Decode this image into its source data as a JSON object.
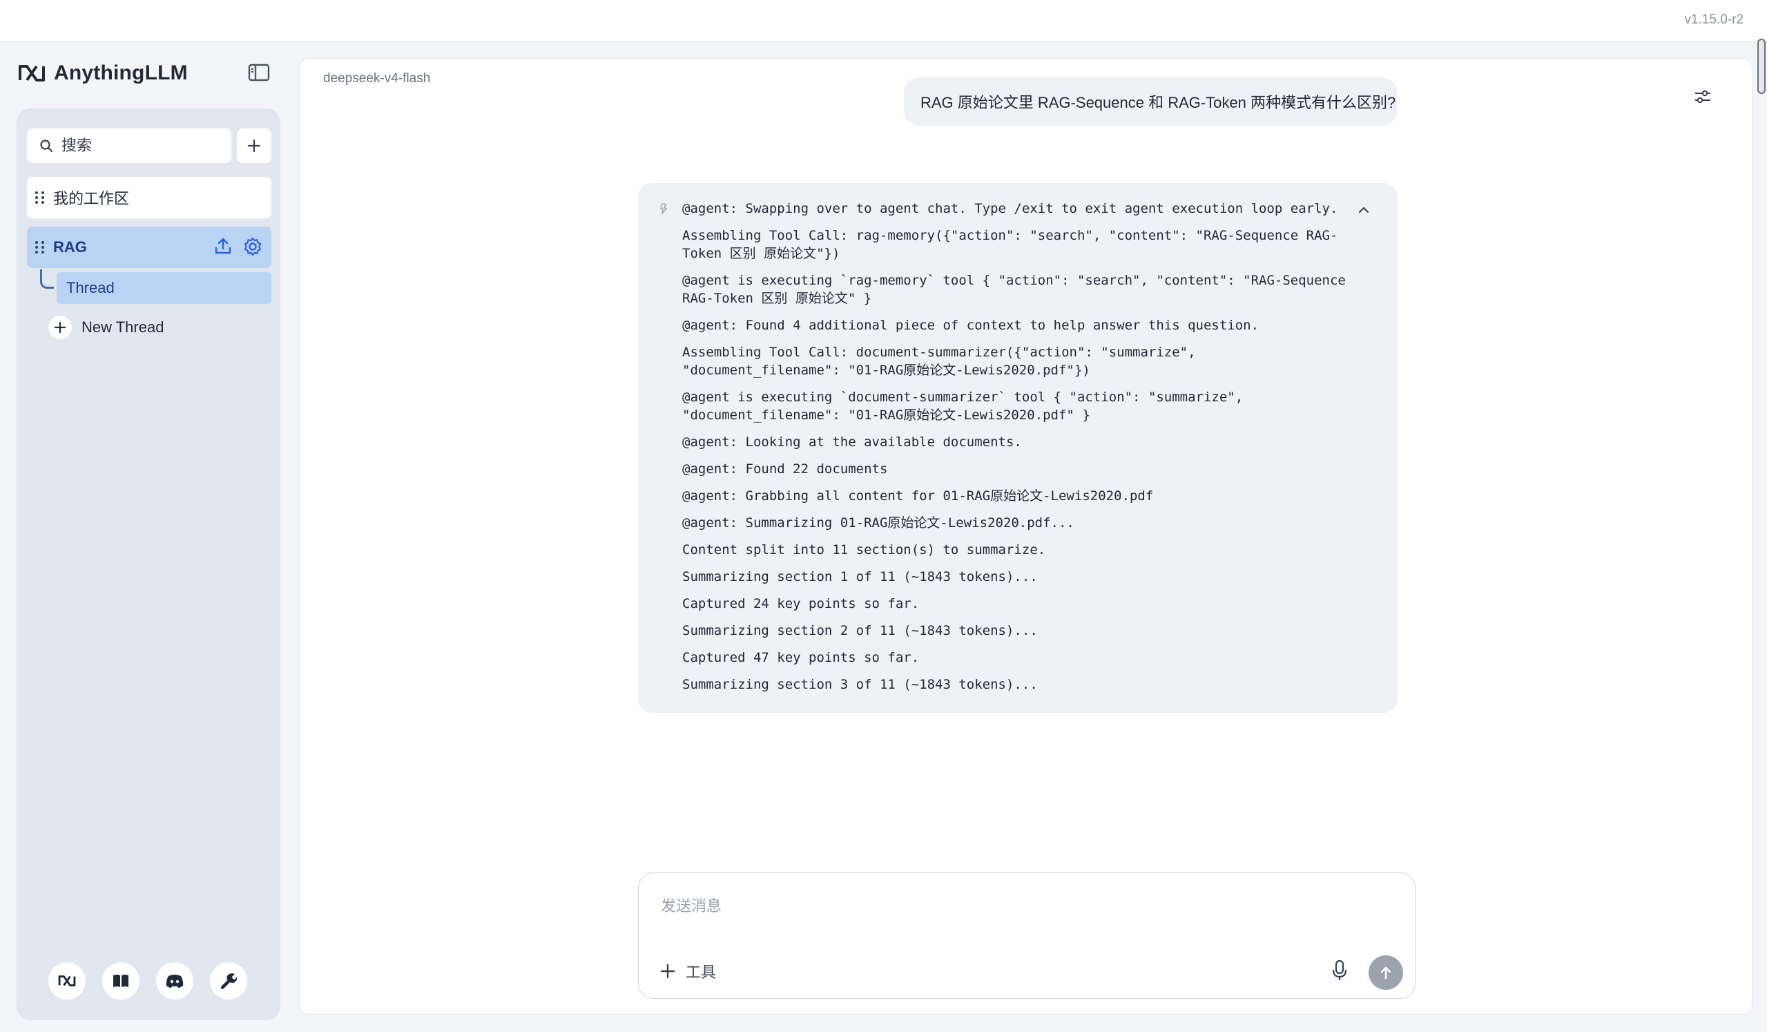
{
  "app": {
    "version": "v1.15.0-r2",
    "brand_name": "AnythingLLM"
  },
  "sidebar": {
    "search_placeholder": "搜索",
    "workspaces": [
      {
        "label": "我的工作区"
      },
      {
        "label": "RAG",
        "active": true
      }
    ],
    "thread": {
      "label": "Thread"
    },
    "new_thread_label": "New Thread",
    "footer_icons": [
      "anythingllm-logo-icon",
      "book-icon",
      "discord-icon",
      "wrench-icon"
    ]
  },
  "chat": {
    "model_name": "deepseek-v4-flash",
    "user_message": "RAG 原始论文里 RAG-Sequence 和 RAG-Token 两种模式有什么区别?",
    "agent_lines": [
      "@agent: Swapping over to agent chat. Type /exit to exit agent execution loop early.",
      "Assembling Tool Call: rag-memory({\"action\": \"search\", \"content\": \"RAG-Sequence RAG-Token 区别 原始论文\"})",
      "@agent is executing `rag-memory` tool { \"action\": \"search\", \"content\": \"RAG-Sequence RAG-Token 区别 原始论文\" }",
      "@agent: Found 4 additional piece of context to help answer this question.",
      "Assembling Tool Call: document-summarizer({\"action\": \"summarize\", \"document_filename\": \"01-RAG原始论文-Lewis2020.pdf\"})",
      "@agent is executing `document-summarizer` tool { \"action\": \"summarize\", \"document_filename\": \"01-RAG原始论文-Lewis2020.pdf\" }",
      "@agent: Looking at the available documents.",
      "@agent: Found 22 documents",
      "@agent: Grabbing all content for 01-RAG原始论文-Lewis2020.pdf",
      "@agent: Summarizing 01-RAG原始论文-Lewis2020.pdf...",
      "Content split into 11 section(s) to summarize.",
      "Summarizing section 1 of 11 (~1843 tokens)...",
      "Captured 24 key points so far.",
      "Summarizing section 2 of 11 (~1843 tokens)...",
      "Captured 47 key points so far.",
      "Summarizing section 3 of 11 (~1843 tokens)..."
    ]
  },
  "composer": {
    "placeholder": "发送消息",
    "tools_label": "工具"
  }
}
